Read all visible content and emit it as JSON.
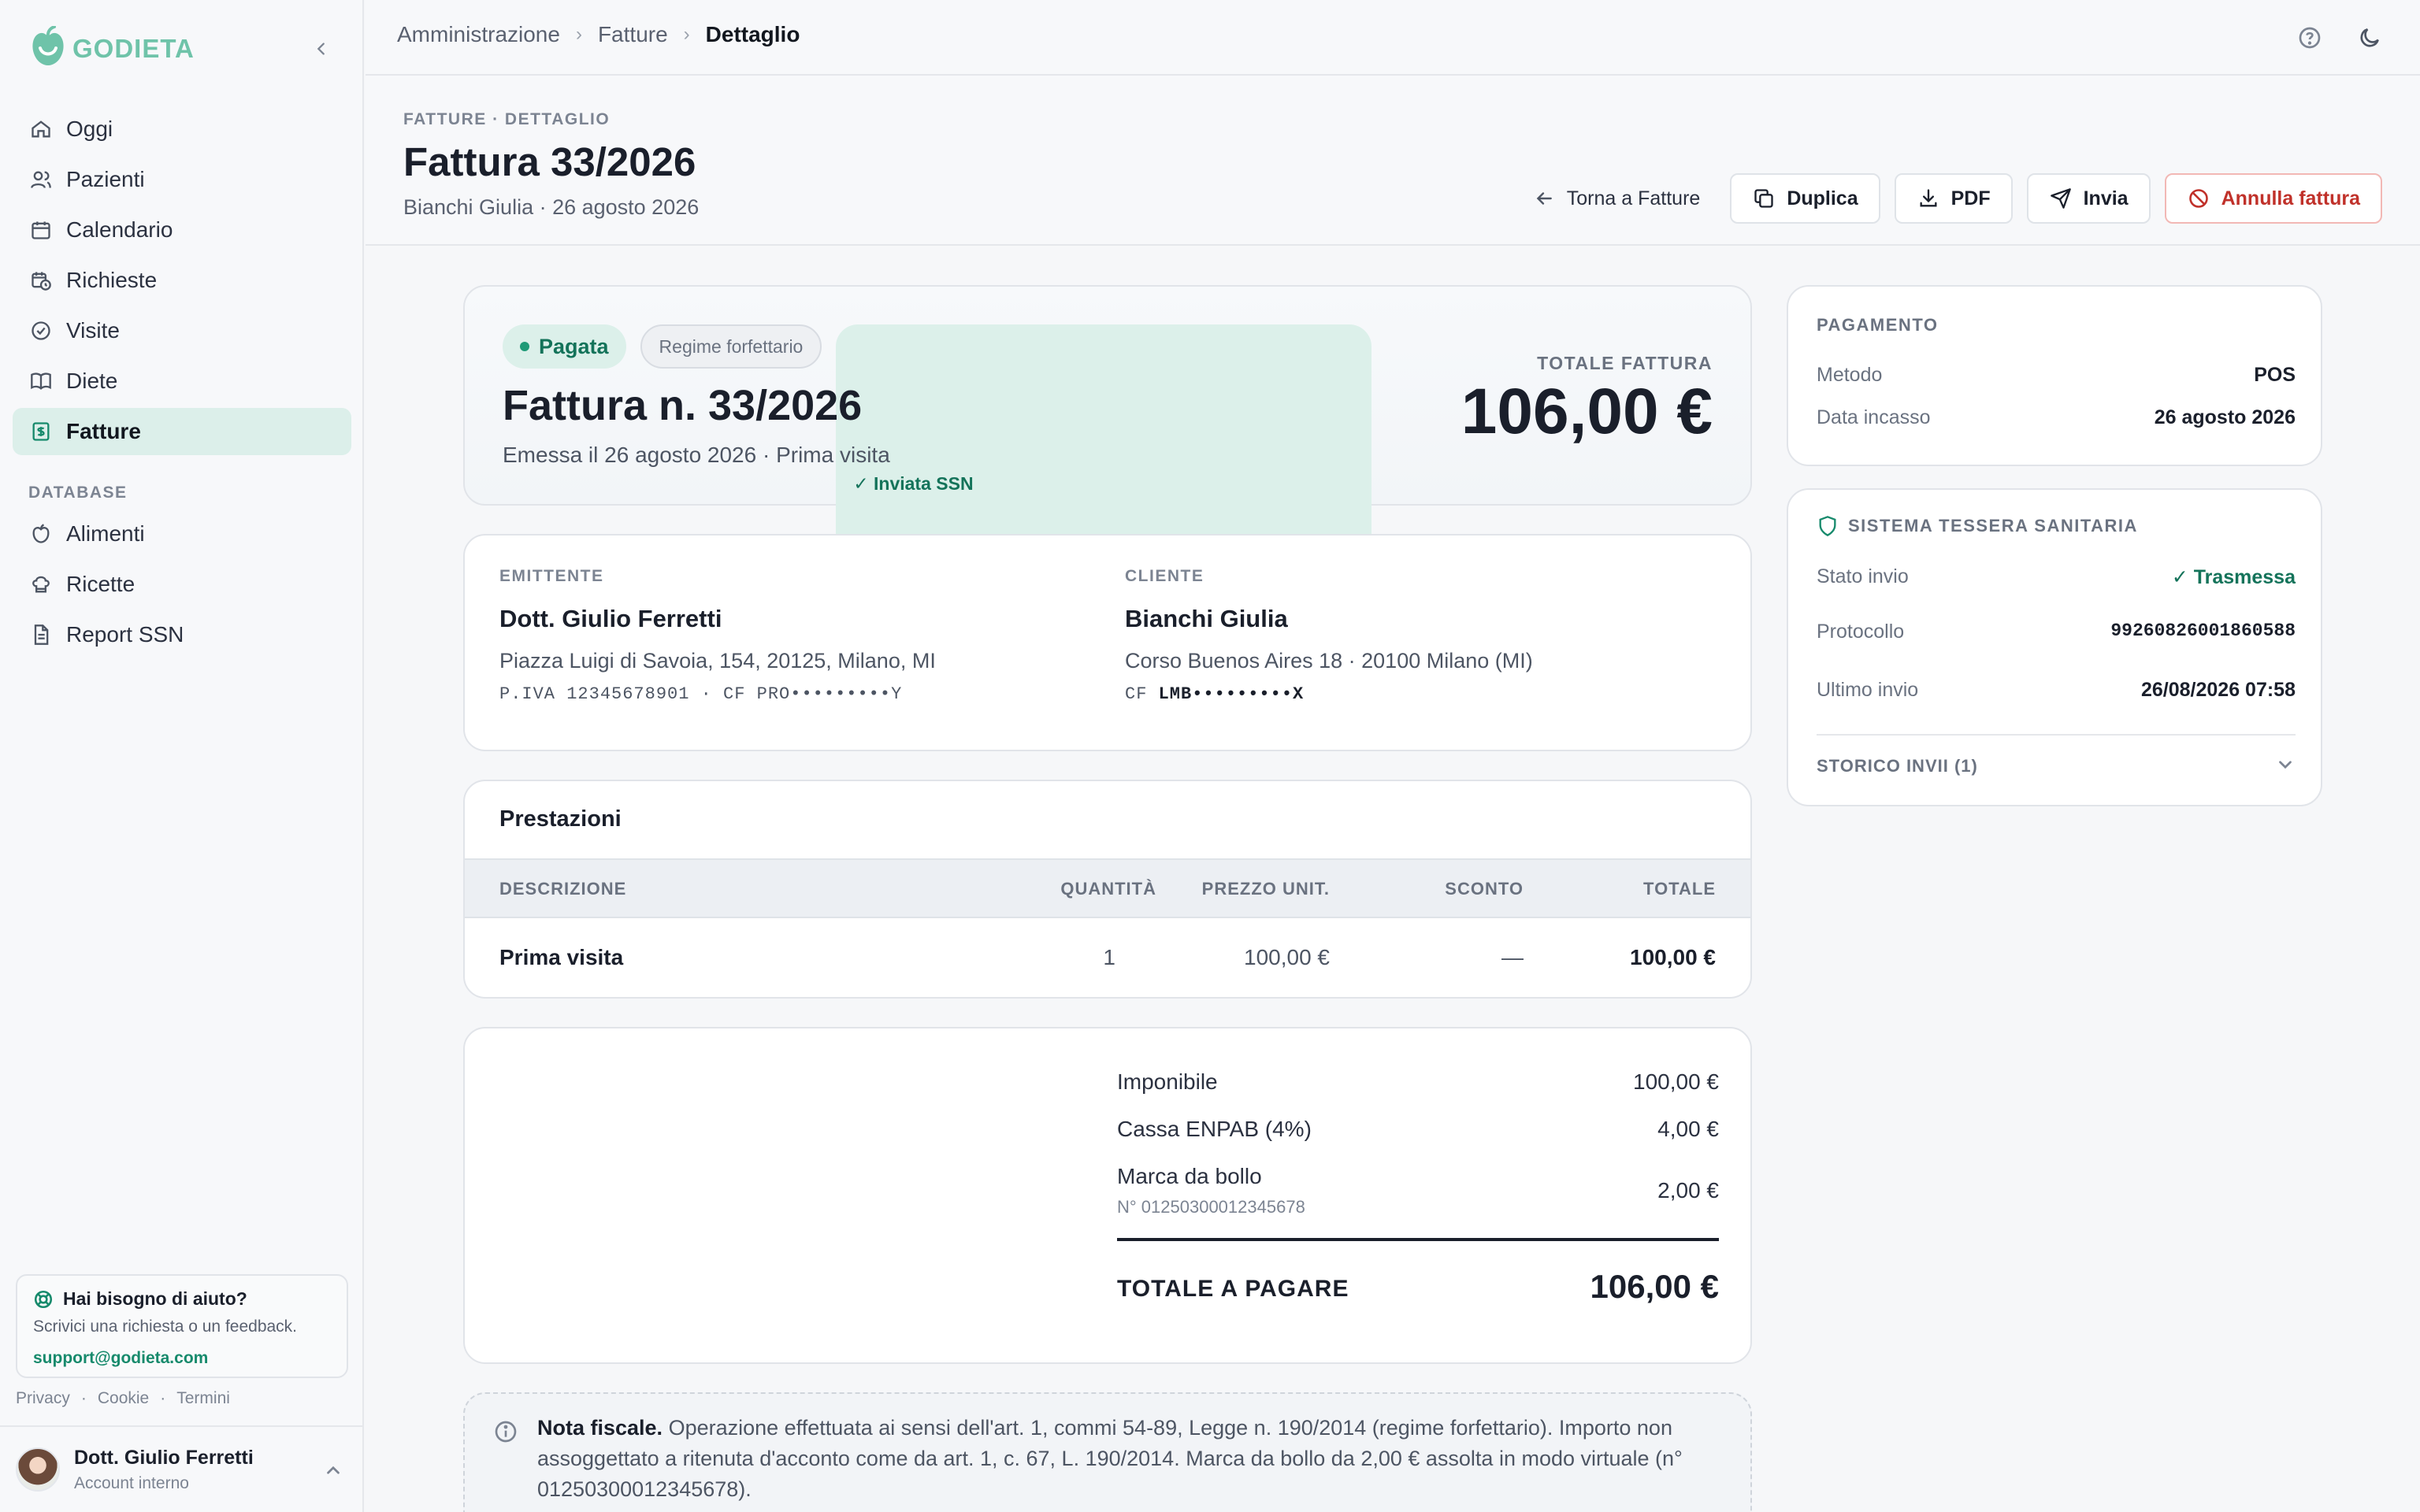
{
  "brand": {
    "name": "GODIETA",
    "accent": "#6fc3a9"
  },
  "sidebar": {
    "items": [
      {
        "label": "Oggi",
        "icon": "home-icon"
      },
      {
        "label": "Pazienti",
        "icon": "users-icon"
      },
      {
        "label": "Calendario",
        "icon": "calendar-icon"
      },
      {
        "label": "Richieste",
        "icon": "calendar-clock-icon"
      },
      {
        "label": "Visite",
        "icon": "check-circle-icon"
      },
      {
        "label": "Diete",
        "icon": "book-icon"
      },
      {
        "label": "Fatture",
        "icon": "receipt-icon",
        "active": true
      }
    ],
    "section_label": "DATABASE",
    "db_items": [
      {
        "label": "Alimenti",
        "icon": "apple-icon"
      },
      {
        "label": "Ricette",
        "icon": "chef-hat-icon"
      },
      {
        "label": "Report SSN",
        "icon": "report-icon"
      }
    ],
    "help": {
      "title": "Hai bisogno di aiuto?",
      "text": "Scrivici una richiesta o un feedback.",
      "email": "support@godieta.com"
    },
    "legal": {
      "privacy": "Privacy",
      "sep": "·",
      "cookie": "Cookie",
      "terms": "Termini"
    },
    "user": {
      "name": "Dott. Giulio Ferretti",
      "role": "Account interno"
    }
  },
  "breadcrumb": {
    "items": [
      "Amministrazione",
      "Fatture"
    ],
    "current": "Dettaglio",
    "sep": "›"
  },
  "header": {
    "eyebrow": "FATTURE · DETTAGLIO",
    "title": "Fattura 33/2026",
    "subtitle": "Bianchi Giulia · 26 agosto 2026",
    "actions": {
      "back": "Torna a Fatture",
      "duplicate": "Duplica",
      "pdf": "PDF",
      "send": "Invia",
      "cancel": "Annulla fattura"
    }
  },
  "invoice": {
    "status": "Pagata",
    "regime": "Regime forfettario",
    "ssn_badge": "✓ Inviata SSN",
    "title": "Fattura n. 33/2026",
    "subtitle": "Emessa il 26 agosto 2026 · Prima visita",
    "total_label": "TOTALE FATTURA",
    "total_value": "106,00 €"
  },
  "issuer": {
    "label": "EMITTENTE",
    "name": "Dott. Giulio Ferretti",
    "address": "Piazza Luigi di Savoia, 154, 20125, Milano, MI",
    "fiscal": "P.IVA 12345678901 · CF PRO•••••••••Y"
  },
  "client": {
    "label": "CLIENTE",
    "name": "Bianchi Giulia",
    "address": "Corso Buenos Aires 18 · 20100 Milano (MI)",
    "cf_prefix": "CF",
    "cf": "LMB•••••••••X"
  },
  "services": {
    "title": "Prestazioni",
    "headers": {
      "desc": "DESCRIZIONE",
      "qty": "QUANTITÀ",
      "price": "PREZZO UNIT.",
      "discount": "SCONTO",
      "total": "TOTALE"
    },
    "rows": [
      {
        "desc": "Prima visita",
        "qty": "1",
        "price": "100,00 €",
        "discount": "—",
        "total": "100,00 €"
      }
    ]
  },
  "totals": {
    "taxable_label": "Imponibile",
    "taxable": "100,00 €",
    "cassa_label": "Cassa ENPAB (4%)",
    "cassa": "4,00 €",
    "stamp_label": "Marca da bollo",
    "stamp_number": "N° 01250300012345678",
    "stamp": "2,00 €",
    "grand_label": "TOTALE A PAGARE",
    "grand": "106,00 €"
  },
  "note": {
    "title": "Nota fiscale.",
    "text": "Operazione effettuata ai sensi dell'art. 1, commi 54-89, Legge n. 190/2014 (regime forfettario). Importo non assoggettato a ritenuta d'acconto come da art. 1, c. 67, L. 190/2014. Marca da bollo da 2,00 € assolta in modo virtuale (n° 01250300012345678)."
  },
  "payment": {
    "title": "PAGAMENTO",
    "method_label": "Metodo",
    "method": "POS",
    "date_label": "Data incasso",
    "date": "26 agosto 2026"
  },
  "ssn": {
    "title": "SISTEMA TESSERA SANITARIA",
    "status_label": "Stato invio",
    "status": "✓ Trasmessa",
    "protocol_label": "Protocollo",
    "protocol": "99260826001860588",
    "last_label": "Ultimo invio",
    "last": "26/08/2026 07:58",
    "history": "STORICO INVII (1)"
  }
}
